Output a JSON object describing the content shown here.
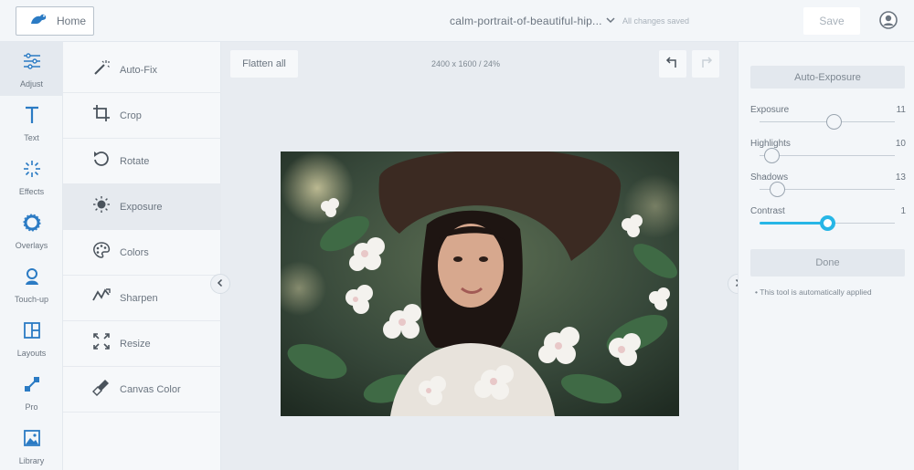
{
  "topbar": {
    "home_label": "Home",
    "filename": "calm-portrait-of-beautiful-hip...",
    "save_status": "All changes saved",
    "save_label": "Save"
  },
  "rail": {
    "items": [
      {
        "label": "Adjust",
        "icon": "sliders-icon",
        "active": true
      },
      {
        "label": "Text",
        "icon": "text-icon"
      },
      {
        "label": "Effects",
        "icon": "sparkle-icon"
      },
      {
        "label": "Overlays",
        "icon": "circle-overlay-icon"
      },
      {
        "label": "Touch-up",
        "icon": "person-icon"
      },
      {
        "label": "Layouts",
        "icon": "layout-icon"
      },
      {
        "label": "Pro",
        "icon": "pro-icon"
      },
      {
        "label": "Library",
        "icon": "image-icon"
      }
    ]
  },
  "tools": {
    "items": [
      {
        "label": "Auto-Fix",
        "icon": "magic-wand-icon"
      },
      {
        "label": "Crop",
        "icon": "crop-icon"
      },
      {
        "label": "Rotate",
        "icon": "rotate-icon"
      },
      {
        "label": "Exposure",
        "icon": "sun-icon",
        "active": true
      },
      {
        "label": "Colors",
        "icon": "palette-icon"
      },
      {
        "label": "Sharpen",
        "icon": "sharpen-icon"
      },
      {
        "label": "Resize",
        "icon": "resize-icon"
      },
      {
        "label": "Canvas Color",
        "icon": "paint-bucket-icon"
      }
    ]
  },
  "canvas": {
    "flatten_label": "Flatten all",
    "dimensions": "2400 x 1600 / 24%"
  },
  "panel": {
    "auto_exposure_label": "Auto-Exposure",
    "sliders": [
      {
        "name": "Exposure",
        "value": "11",
        "level": 0.55
      },
      {
        "name": "Highlights",
        "value": "10",
        "level": 0.09
      },
      {
        "name": "Shadows",
        "value": "13",
        "level": 0.13
      },
      {
        "name": "Contrast",
        "value": "1",
        "level": 0.5,
        "active": true
      }
    ],
    "done_label": "Done",
    "hint": "This tool is automatically applied"
  },
  "colors": {
    "accent": "#27b6e6",
    "logo": "#2b7bc4"
  }
}
